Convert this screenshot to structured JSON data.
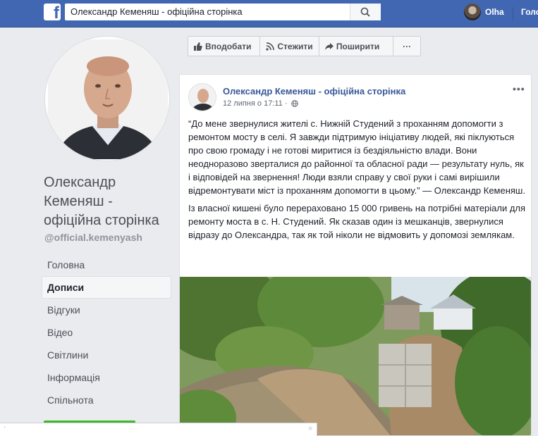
{
  "topbar": {
    "logo_letter": "f",
    "search_value": "Олександр Кеменяш - офіційна сторінка",
    "user_name": "Olha",
    "home_label": "Головна"
  },
  "page": {
    "name": "Олександр Кеменяш - офіційна сторінка",
    "handle": "@official.kemenyash"
  },
  "nav": {
    "items": [
      "Головна",
      "Дописи",
      "Відгуки",
      "Відео",
      "Світлини",
      "Інформація",
      "Спільнота"
    ],
    "active": "Дописи"
  },
  "actions": {
    "like": "Вподобати",
    "follow": "Стежити",
    "share": "Поширити",
    "more": "···"
  },
  "post": {
    "author": "Олександр Кеменяш - офіційна сторінка",
    "time": "12 липня о 17:11 ·",
    "more": "•••",
    "paragraph1": "“До мене звернулися жителі с. Нижній Студений з проханням допомогти з ремонтом мосту в селі. Я завжди підтримую ініціативу людей, які піклуються про свою громаду і не готові миритися із бездіяльністю влади. Вони неодноразово зверталися до районної та обласної ради — результату нуль, як і відповідей на звернення! Люди взяли справу у свої руки і самі вирішили відремонтувати міст із проханням допомогти в цьому.” — Олександр Кеменяш.",
    "paragraph2": "Із власної кишені було перераховано 15 000 гривень на потрібні матеріали для ремонту моста в с. Н. Студений. Як сказав один із мешканців, звернулися відразу до Олександра, так як той ніколи не відмовить у допомозі землякам."
  },
  "colors": {
    "topbar": "#4267b2",
    "link": "#385898",
    "background": "#e9ebee"
  }
}
